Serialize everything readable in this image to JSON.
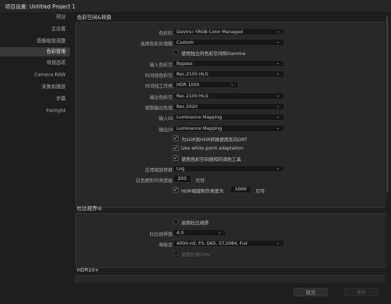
{
  "window": {
    "title_prefix": "项目设置:",
    "project_name": "Untitled Project 1"
  },
  "sidebar": {
    "items": [
      {
        "label": "预设"
      },
      {
        "label": "主设置"
      },
      {
        "label": "图像缩放调整"
      },
      {
        "label": "色彩管理",
        "active": true
      },
      {
        "label": "常规选项"
      },
      {
        "label": "Camera RAW"
      },
      {
        "label": "采集和播放"
      },
      {
        "label": "字幕"
      },
      {
        "label": "Fairlight"
      }
    ]
  },
  "color_space": {
    "section_title": "色彩空间&转换",
    "color_science": {
      "label": "色彩科学",
      "value": "DaVinci YRGB Color Managed"
    },
    "color_processing_mode": {
      "label": "选择色彩处理模式",
      "value": "Custom"
    },
    "separate_gamma": {
      "label": "使用独立的色彩空间和Gamma",
      "checked": false
    },
    "input_color_space": {
      "label": "输入色彩空间",
      "value": "Bypass"
    },
    "timeline_color_space": {
      "label": "时间线色彩空间",
      "value": "Rec.2100 HLG"
    },
    "timeline_working_luminance": {
      "label": "时间线工作亮度",
      "value": "HDR 1000"
    },
    "output_color_space": {
      "label": "输出色彩空间",
      "value": "Rec.2100 HLG"
    },
    "limit_output_gamut": {
      "label": "限制输出色域到",
      "value": "Rec.2020"
    },
    "input_drt": {
      "label": "输入DRT",
      "value": "Luminance Mapping"
    },
    "output_drt": {
      "label": "输出DRT",
      "value": "Luminance Mapping"
    },
    "inverse_drt": {
      "label": "为SDR到HDR转换使用反向DRT",
      "checked": true
    },
    "white_point_adaptation": {
      "label": "Use white point adaptation",
      "checked": true
    },
    "color_space_aware_tools": {
      "label": "使用色彩空间感知的调色工具",
      "checked": true
    },
    "graphics_white": {
      "label": "白色图形的亮度级别",
      "value": "203",
      "unit": "尼特"
    },
    "apply_resize": {
      "label": "应用缩放转换于",
      "value": "Log"
    },
    "hdr_mastering": {
      "label": "HDR母版制作亮度为",
      "checked": true,
      "value": "1000",
      "unit": "尼特"
    }
  },
  "dolby": {
    "section_title": "杜比视界®",
    "enable": {
      "label": "启用杜比视界",
      "checked": false
    },
    "version": {
      "label": "杜比视界版本",
      "value": "4.0"
    },
    "master_display": {
      "label": "母板显示",
      "value": "4000-nit, P3, D65, ST.2084, Full"
    },
    "external_cmu": {
      "label": "使用外部CMU",
      "checked": false
    }
  },
  "hdr10": {
    "section_title": "HDR10+"
  },
  "footer": {
    "cancel_label": "取消",
    "save_label": "保存"
  }
}
